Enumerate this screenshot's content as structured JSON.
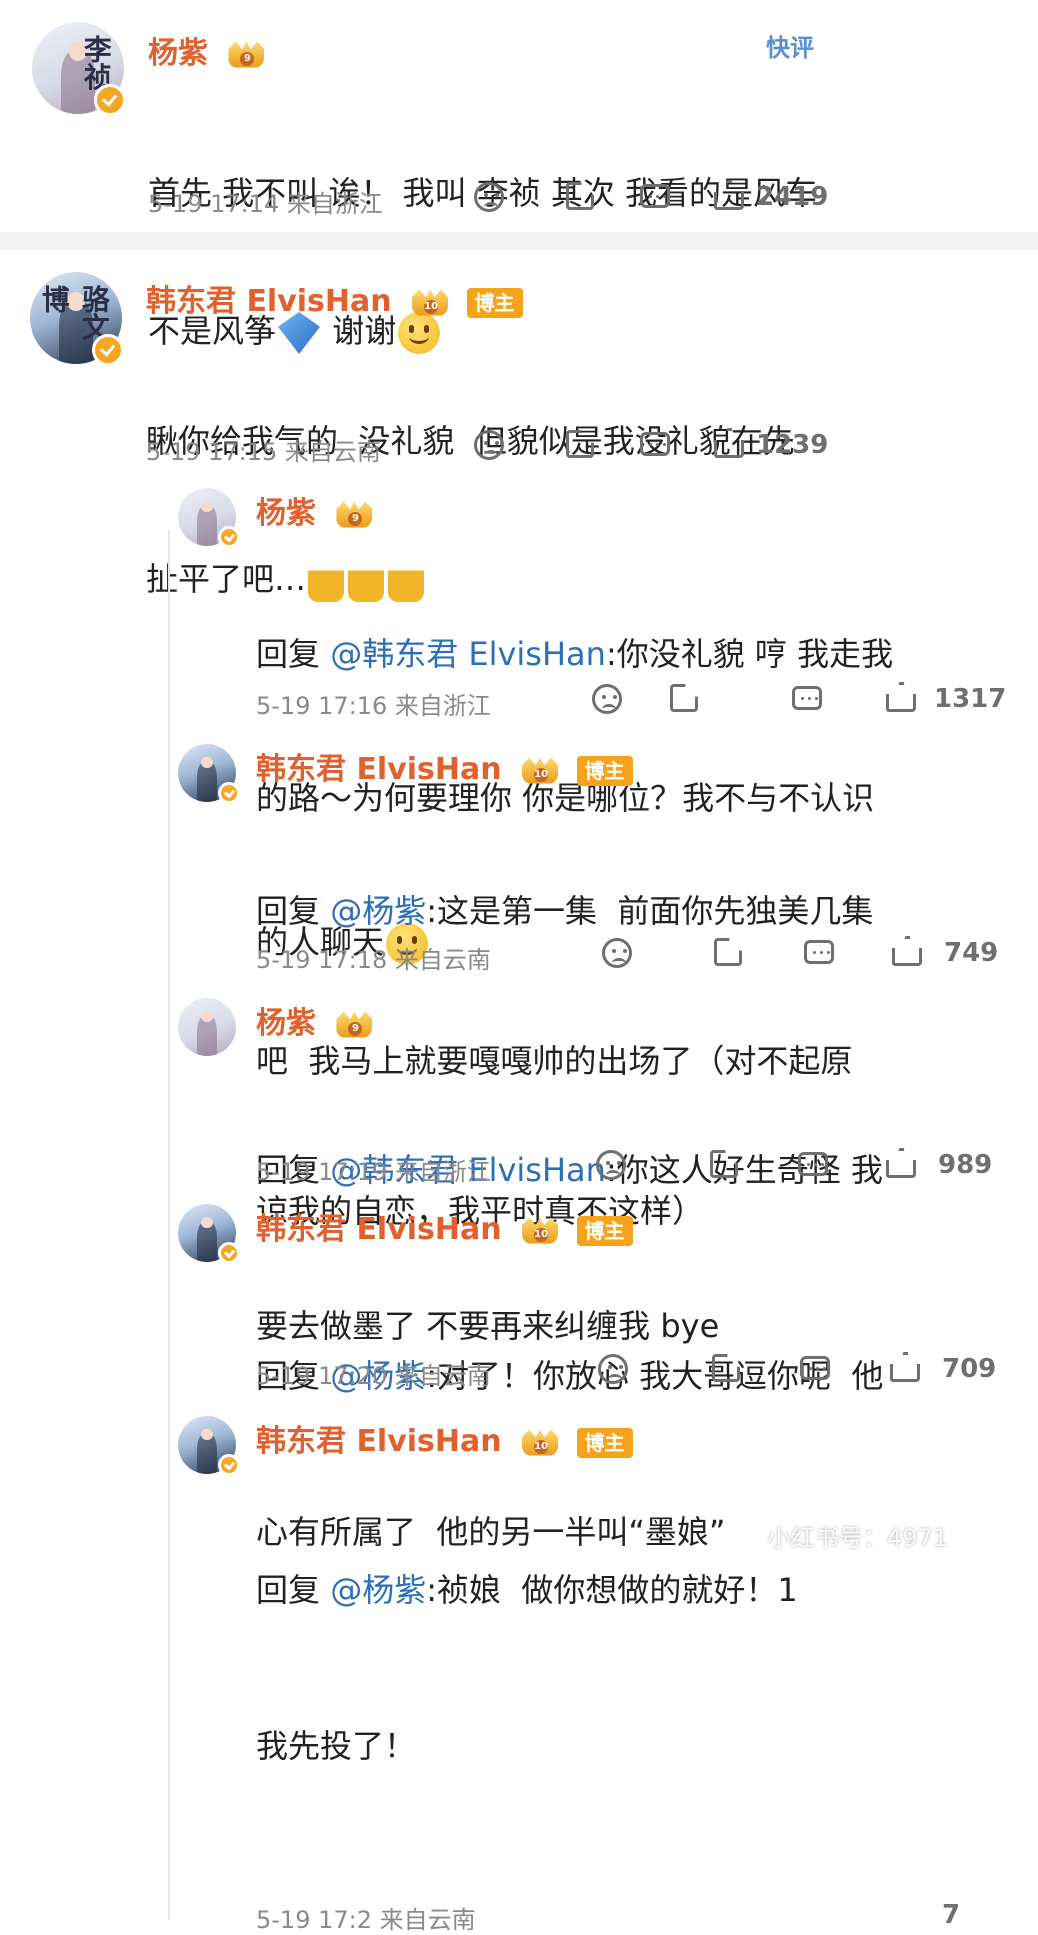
{
  "top_action": "快评",
  "comments": [
    {
      "user": "杨紫",
      "level": "9",
      "avatar_text": "李祯",
      "text_lines": [
        "首先 我不叫 诶！ 我叫 李祯 其次 我看的是风车",
        "不是风筝"
      ],
      "text_tail": "谢谢",
      "time": "5-19 17:14",
      "location": "来自浙江",
      "likes": "2419"
    },
    {
      "user": "韩东君 ElvisHan",
      "level": "10",
      "badge": "博主",
      "avatar_text": "骆文博",
      "text_lines": [
        "瞅你给我气的  没礼貌  但貌似是我没礼貌在先",
        "扯平了吧…"
      ],
      "time": "5-19 17:15",
      "location": "来自云南",
      "likes": "1239"
    }
  ],
  "replies": [
    {
      "user": "杨紫",
      "level": "9",
      "reply_prefix": "回复",
      "mention": "@韩东君 ElvisHan",
      "lines": [
        ":你没礼貌 哼 我走我",
        "的路～为何要理你 你是哪位？我不与不认识",
        "的人聊天"
      ],
      "time": "5-19 17:16",
      "location": "来自浙江",
      "likes": "1317"
    },
    {
      "user": "韩东君 ElvisHan",
      "level": "10",
      "badge": "博主",
      "reply_prefix": "回复",
      "mention": "@杨紫",
      "lines": [
        ":这是第一集  前面你先独美几集",
        "吧  我马上就要嘎嘎帅的出场了（对不起原",
        "谅我的自恋，我平时真不这样）"
      ],
      "time": "5-19 17:18",
      "location": "来自云南",
      "likes": "749"
    },
    {
      "user": "杨紫",
      "level": "9",
      "reply_prefix": "回复",
      "mention": "@韩东君 ElvisHan",
      "lines": [
        ":你这人好生奇怪 我",
        "要去做墨了 不要再来纠缠我 bye"
      ],
      "time": "5-19 17:19",
      "location": "来自浙江",
      "likes": "989"
    },
    {
      "user": "韩东君 ElvisHan",
      "level": "10",
      "badge": "博主",
      "reply_prefix": "回复",
      "mention": "@杨紫",
      "lines": [
        ":对了！你放心 我大哥逗你呢  他",
        "心有所属了  他的另一半叫“墨娘”"
      ],
      "time": "5-19 17:20",
      "location": "来自云南",
      "likes": "709"
    },
    {
      "user": "韩东君 ElvisHan",
      "level": "10",
      "badge": "博主",
      "reply_prefix": "回复",
      "mention": "@杨紫",
      "lines": [
        ":祯娘  做你想做的就好！1",
        "我先投了！"
      ],
      "time": "5-19 17:2",
      "location": "来自云南",
      "likes": "7"
    }
  ],
  "watermark": "小红书号：4971"
}
